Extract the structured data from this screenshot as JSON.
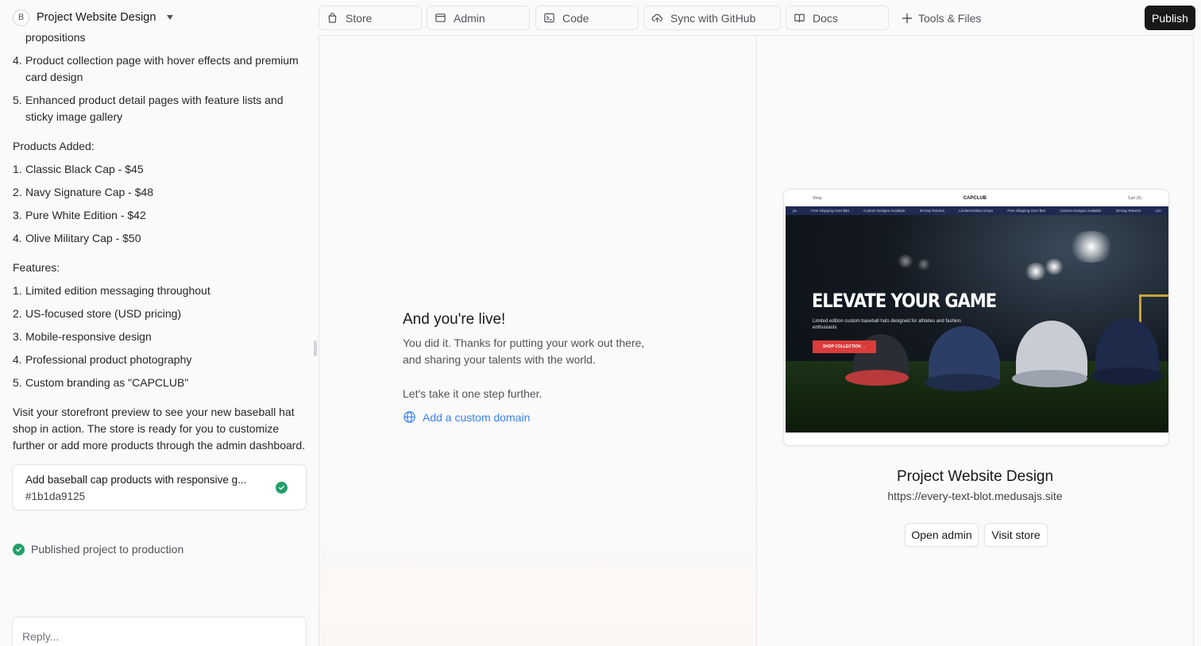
{
  "project": {
    "avatar_letter": "B",
    "title": "Project Website Design"
  },
  "tabs": [
    {
      "label": "Store",
      "icon": "bag-icon"
    },
    {
      "label": "Admin",
      "icon": "window-icon"
    },
    {
      "label": "Code",
      "icon": "terminal-icon"
    },
    {
      "label": "Sync with GitHub",
      "icon": "cloud-upload-icon"
    },
    {
      "label": "Docs",
      "icon": "book-icon"
    }
  ],
  "tools_label": "Tools & Files",
  "publish_label": "Publish",
  "chat": {
    "partial_line": "propositions",
    "design_items": [
      {
        "num": "4.",
        "text": "Product collection page with hover effects and premium card design"
      },
      {
        "num": "5.",
        "text": "Enhanced product detail pages with feature lists and sticky image gallery"
      }
    ],
    "products_heading": "Products Added:",
    "products": [
      {
        "num": "1.",
        "text": "Classic Black Cap - $45"
      },
      {
        "num": "2.",
        "text": "Navy Signature Cap - $48"
      },
      {
        "num": "3.",
        "text": "Pure White Edition - $42"
      },
      {
        "num": "4.",
        "text": "Olive Military Cap - $50"
      }
    ],
    "features_heading": "Features:",
    "features": [
      {
        "num": "1.",
        "text": "Limited edition messaging throughout"
      },
      {
        "num": "2.",
        "text": "US-focused store (USD pricing)"
      },
      {
        "num": "3.",
        "text": "Mobile-responsive design"
      },
      {
        "num": "4.",
        "text": "Professional product photography"
      },
      {
        "num": "5.",
        "text": "Custom branding as \"CAPCLUB\""
      }
    ],
    "closing": "Visit your storefront preview to see your new baseball hat shop in action. The store is ready for you to customize further or add more products through the admin dashboard.",
    "commit": {
      "title": "Add baseball cap products with responsive g...",
      "hash": "#1b1da9125"
    },
    "published_text": "Published project to production",
    "reply_placeholder": "Reply..."
  },
  "live": {
    "title": "And you're live!",
    "text": "You did it. Thanks for putting your work out there, and sharing your talents with the world.",
    "step": "Let's take it one step further.",
    "domain_link": "Add a custom domain"
  },
  "preview": {
    "nav_left": "Shop",
    "brand": "CAPCLUB",
    "nav_right": "Cart (0)",
    "ticker": [
      "ps",
      "Free Shipping Over $50",
      "Custom Designs Available",
      "30-Day Returns",
      "Limited Edition Drops",
      "Free Shipping Over $50",
      "Custom Designs Available",
      "30-Day Returns",
      "Lim"
    ],
    "hero_title": "ELEVATE YOUR GAME",
    "hero_sub": "Limited edition custom baseball hats designed for athletes and fashion enthusiasts",
    "hero_button": "SHOP COLLECTION →"
  },
  "site": {
    "title": "Project Website Design",
    "url": "https://every-text-blot.medusajs.site",
    "open_admin": "Open admin",
    "visit_store": "Visit store"
  },
  "colors": {
    "accent_link": "#3b82f6",
    "success": "#22a06b",
    "publish_bg": "#18181b",
    "hero_button": "#dc3b3b"
  }
}
